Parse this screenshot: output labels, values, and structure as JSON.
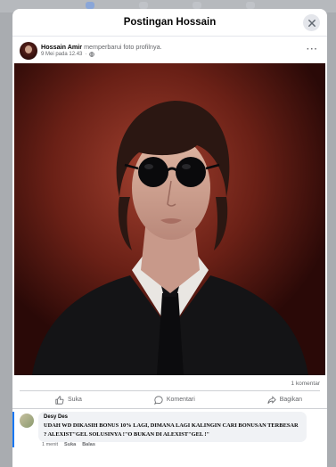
{
  "modal": {
    "title": "Postingan Hossain"
  },
  "post": {
    "author": "Hossain Amir",
    "action": " memperbarui foto profilnya.",
    "date": "9 Mei pada 12.43",
    "privacy_icon": "globe-icon"
  },
  "photo": {
    "description_icon": "profile-photo"
  },
  "stats": {
    "comments": "1 komentar"
  },
  "actions": {
    "like": "Suka",
    "comment": "Komentari",
    "share": "Bagikan"
  },
  "comment": {
    "author": "Desy Des",
    "text": "UDAH WD DIKASIH BONUS 10% LAGI, DIMANA LAGI KALINGIN CARI BONUSAN TERBESAR ? ALEXIST\"GEL SOLUSINYA !\"O BUKAN DI ALEXIST\"GEL !\"",
    "time": "1 menit",
    "like": "Suka",
    "reply": "Balas"
  },
  "colors": {
    "accent": "#1877f2",
    "photo_bg": "#6e2218"
  }
}
